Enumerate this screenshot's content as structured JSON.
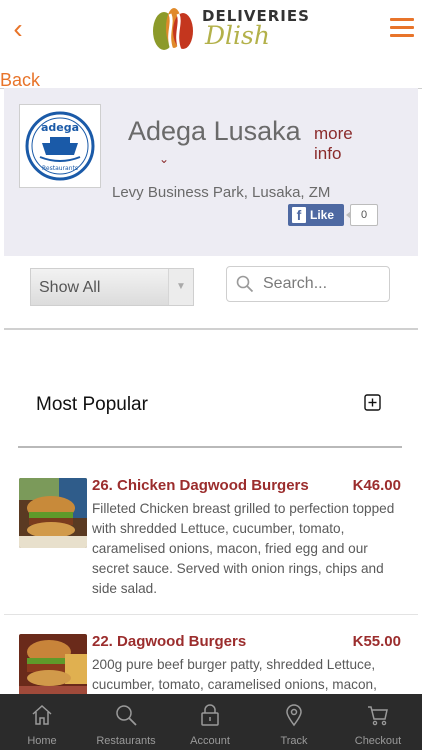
{
  "app": {
    "brand_top": "DELIVERIES",
    "brand_bottom": "Dlish"
  },
  "nav": {
    "back_label": "Back"
  },
  "restaurant": {
    "name": "Adega Lusaka",
    "more_info": "more info",
    "address": "Levy Business Park, Lusaka, ZM",
    "logo_text_top": "adega",
    "logo_text_bottom": "Restaurants"
  },
  "facebook": {
    "like_label": "Like",
    "like_count": "0"
  },
  "filter": {
    "selected": "Show All",
    "search_placeholder": "Search..."
  },
  "section": {
    "title": "Most Popular"
  },
  "items": [
    {
      "name": "26. Chicken Dagwood Burgers",
      "price": "K46.00",
      "description": "Filleted Chicken breast grilled to perfection topped with shredded Lettuce, cucumber, tomato, caramelised onions, macon, fried egg and our secret sauce. Served with onion rings, chips and side salad."
    },
    {
      "name": "22. Dagwood Burgers",
      "price": "K55.00",
      "description": "200g pure beef burger patty, shredded Lettuce, cucumber, tomato, caramelised onions, macon,"
    }
  ],
  "bottom_nav": [
    {
      "label": "Home",
      "icon": "home-icon"
    },
    {
      "label": "Restaurants",
      "icon": "search-icon"
    },
    {
      "label": "Account",
      "icon": "lock-icon"
    },
    {
      "label": "Track",
      "icon": "map-pin-icon"
    },
    {
      "label": "Checkout",
      "icon": "cart-icon"
    }
  ],
  "colors": {
    "accent": "#e8742a",
    "item_title": "#9b2d2d",
    "header_bg": "#edecf3",
    "nav_bg": "#2b2b2b",
    "facebook": "#4e69a2"
  }
}
